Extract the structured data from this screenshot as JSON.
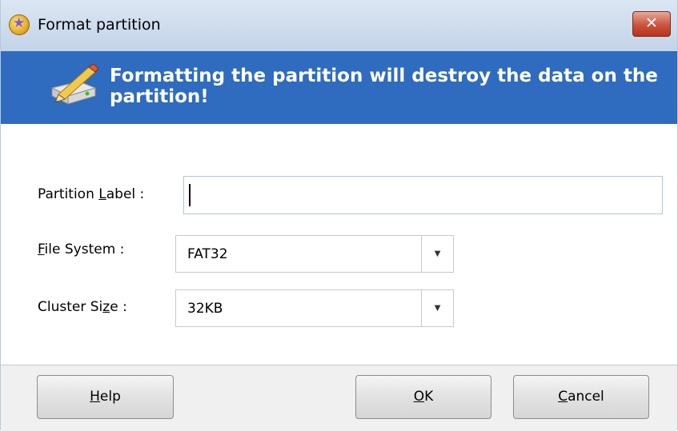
{
  "window": {
    "title": "Format partition",
    "close_label": "✕"
  },
  "banner": {
    "message": "Formatting the partition will destroy the data on the partition!",
    "icon": "format-drive-icon"
  },
  "form": {
    "partition_label": {
      "label_prefix": "Partition ",
      "label_mnemonic": "L",
      "label_suffix": "abel :",
      "value": ""
    },
    "file_system": {
      "label_mnemonic": "F",
      "label_suffix": "ile System :",
      "value": "FAT32"
    },
    "cluster_size": {
      "label_prefix": "Cluster Si",
      "label_mnemonic": "z",
      "label_suffix": "e :",
      "value": "32KB"
    }
  },
  "buttons": {
    "help": {
      "mnemonic": "H",
      "rest": "elp"
    },
    "ok": {
      "mnemonic": "O",
      "rest": "K"
    },
    "cancel": {
      "mnemonic": "C",
      "rest": "ancel"
    }
  },
  "colors": {
    "banner_bg": "#2f6bbf",
    "close_button": "#c9543c"
  }
}
